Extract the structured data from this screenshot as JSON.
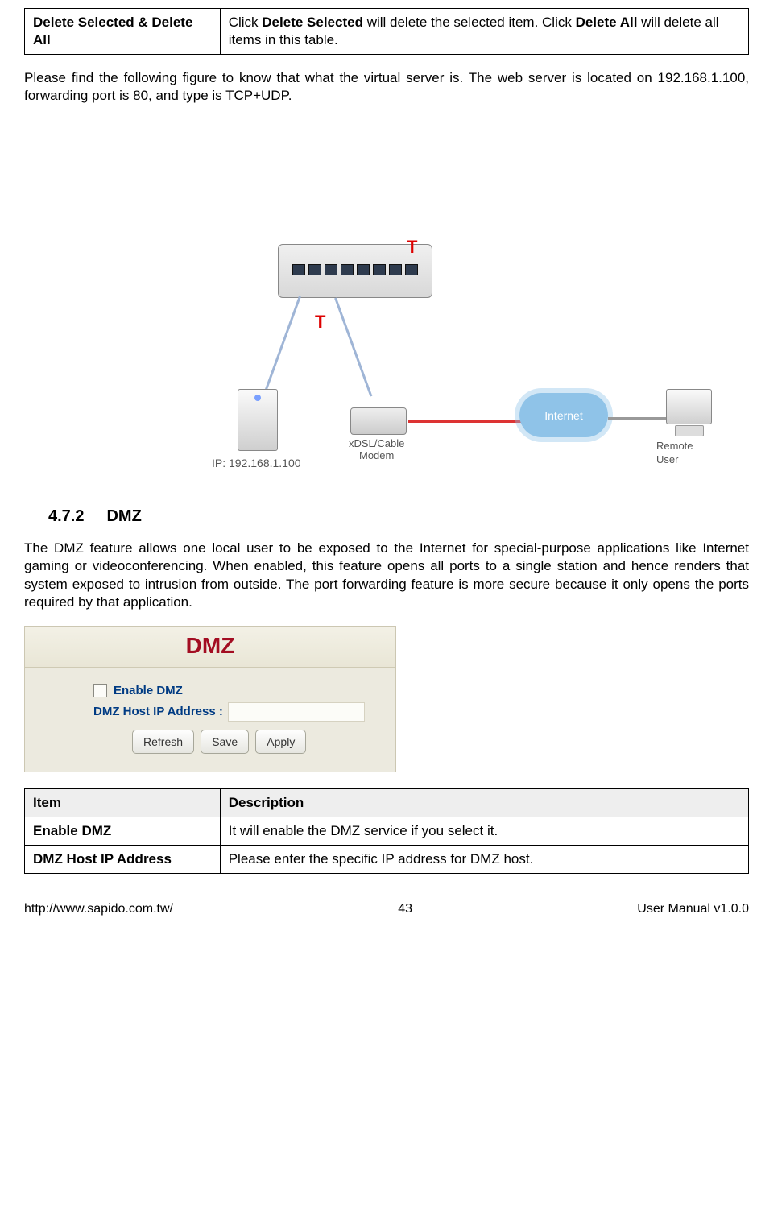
{
  "top_table": {
    "left": "Delete Selected & Delete All",
    "right_pre": "Click ",
    "right_b1": "Delete Selected",
    "right_mid": " will delete the selected item. Click ",
    "right_b2": "Delete All",
    "right_post": " will delete all items in this table."
  },
  "para1": "Please find the following figure to know that what the virtual server is. The web server is located on 192.168.1.100, forwarding port is 80, and type is TCP+UDP.",
  "diagram": {
    "server_ip": "IP: 192.168.1.100",
    "modem": "xDSL/Cable\nModem",
    "internet": "Internet",
    "remote": "Remote User"
  },
  "section": {
    "num": "4.7.2",
    "title": "DMZ"
  },
  "para2": "The DMZ feature allows one local user to be exposed to the Internet for special-purpose applications like Internet gaming or videoconferencing. When enabled, this feature opens all ports to a single station and hence renders that system exposed to intrusion from outside. The port forwarding feature is more secure because it only opens the ports required by that application.",
  "dmz_panel": {
    "title": "DMZ",
    "enable": "Enable DMZ",
    "host_label": "DMZ Host IP Address :",
    "buttons": [
      "Refresh",
      "Save",
      "Apply"
    ]
  },
  "bottom_table": {
    "hdr_item": "Item",
    "hdr_desc": "Description",
    "rows": [
      {
        "item": "Enable DMZ",
        "desc": "It will enable the DMZ service if you select it."
      },
      {
        "item": "DMZ Host IP Address",
        "desc": "Please enter the specific IP address for DMZ host."
      }
    ]
  },
  "footer": {
    "url": "http://www.sapido.com.tw/",
    "page": "43",
    "ver": "User Manual v1.0.0"
  }
}
